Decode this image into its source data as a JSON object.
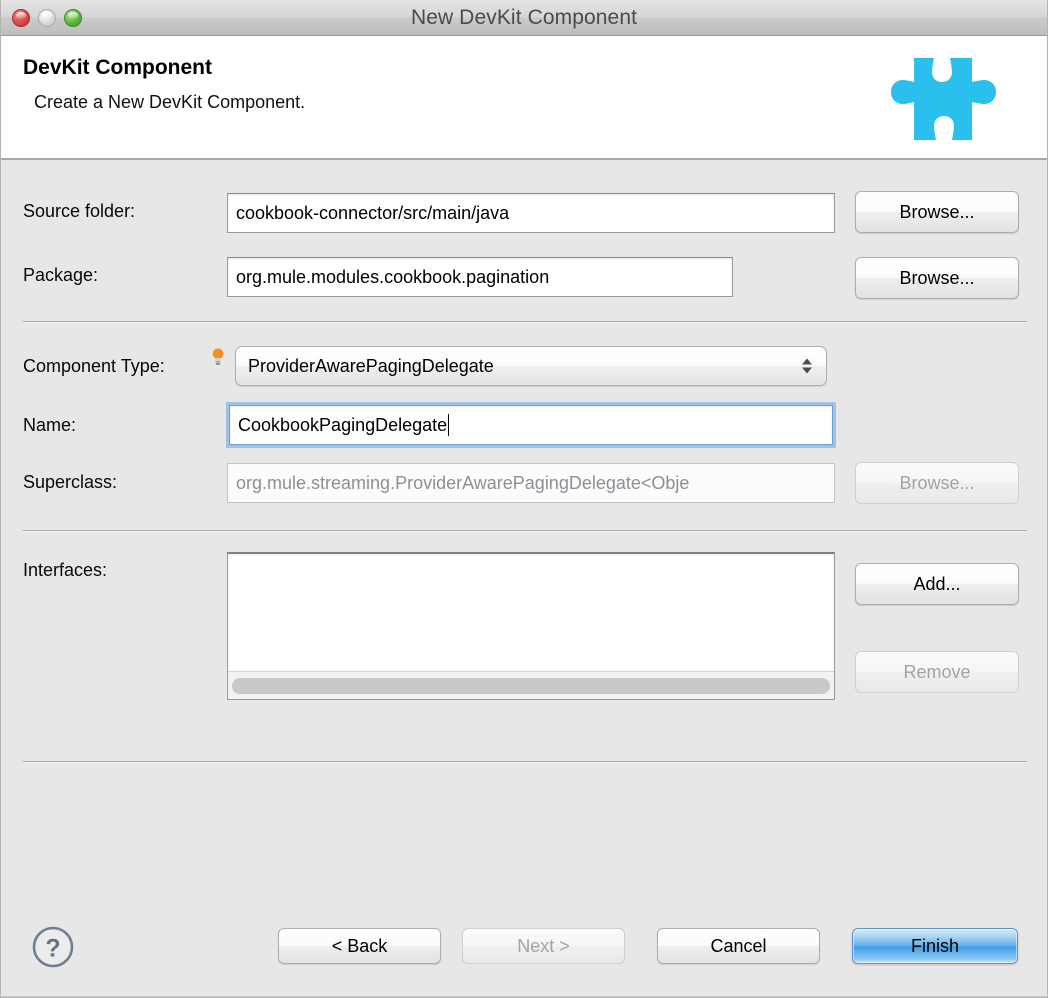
{
  "window": {
    "title": "New DevKit Component",
    "controls": {
      "close": "close-button",
      "minimize": "minimize-button",
      "zoom": "zoom-button"
    }
  },
  "header": {
    "title": "DevKit Component",
    "description": "Create a New DevKit Component.",
    "icon": "puzzle-piece-icon",
    "icon_color": "#2bbfee"
  },
  "form": {
    "source_folder": {
      "label": "Source folder:",
      "value": "cookbook-connector/src/main/java",
      "placeholder": "",
      "browse_label": "Browse..."
    },
    "package": {
      "label": "Package:",
      "value": "org.mule.modules.cookbook.pagination",
      "placeholder": "",
      "browse_label": "Browse..."
    },
    "component_type": {
      "label": "Component Type:",
      "hint_icon": "lightbulb-icon",
      "selected": "ProviderAwarePagingDelegate",
      "options": [
        "ProviderAwarePagingDelegate"
      ]
    },
    "name": {
      "label": "Name:",
      "value": "CookbookPagingDelegate",
      "focused": true
    },
    "superclass": {
      "label": "Superclass:",
      "value": "org.mule.streaming.ProviderAwarePagingDelegate<Obje",
      "disabled": true,
      "browse_label": "Browse..."
    },
    "interfaces": {
      "label": "Interfaces:",
      "items": [],
      "add_label": "Add...",
      "remove_label": "Remove",
      "remove_disabled": true
    }
  },
  "footer": {
    "help_icon": "help-question-icon",
    "back_label": "< Back",
    "next_label": "Next >",
    "next_disabled": true,
    "cancel_label": "Cancel",
    "finish_label": "Finish",
    "finish_default": true,
    "accent_color": "#4f9fe0"
  }
}
